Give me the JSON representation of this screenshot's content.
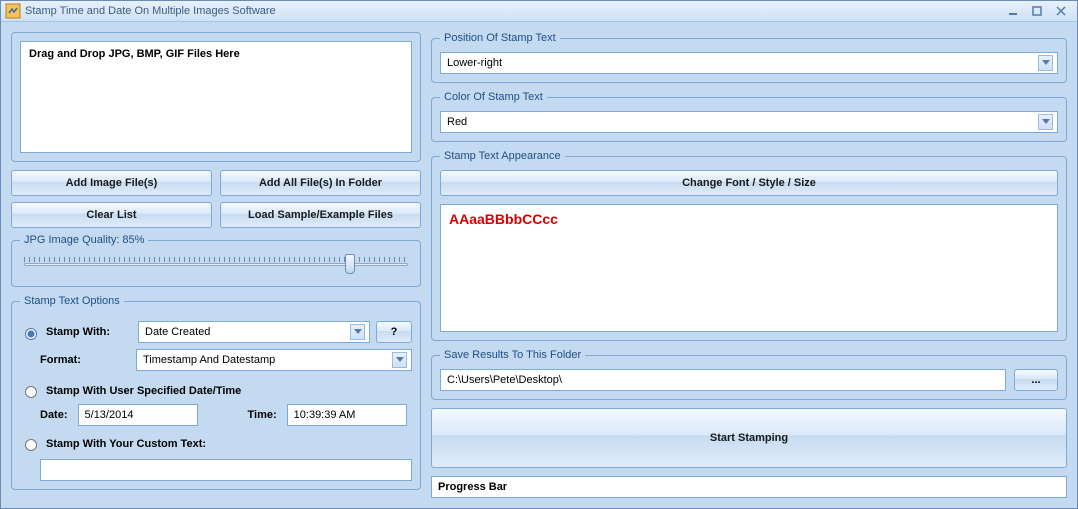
{
  "window": {
    "title": "Stamp Time and Date On Multiple Images Software"
  },
  "left": {
    "drop_placeholder": "Drag and Drop JPG, BMP, GIF Files Here",
    "btn_add_files": "Add Image File(s)",
    "btn_add_folder": "Add All File(s) In Folder",
    "btn_clear": "Clear List",
    "btn_load_sample": "Load Sample/Example Files",
    "quality": {
      "legend": "JPG Image Quality: 85%",
      "percent": 85
    },
    "stamp_options": {
      "legend": "Stamp Text Options",
      "radio_with_label": "Stamp With:",
      "with_value": "Date Created",
      "help_label": "?",
      "format_label": "Format:",
      "format_value": "Timestamp And Datestamp",
      "radio_userdt_label": "Stamp With User Specified Date/Time",
      "date_label": "Date:",
      "date_value": "5/13/2014",
      "time_label": "Time:",
      "time_value": "10:39:39 AM",
      "radio_custom_label": "Stamp With Your Custom Text:",
      "custom_text_value": ""
    }
  },
  "right": {
    "position": {
      "legend": "Position Of Stamp Text",
      "value": "Lower-right"
    },
    "color": {
      "legend": "Color Of Stamp Text",
      "value": "Red"
    },
    "appearance": {
      "legend": "Stamp Text Appearance",
      "btn_font": "Change Font / Style / Size",
      "preview_text": "AAaaBBbbCCcc",
      "preview_color": "#d80000"
    },
    "save": {
      "legend": "Save Results To This Folder",
      "path": "C:\\Users\\Pete\\Desktop\\",
      "browse": "..."
    },
    "btn_start": "Start Stamping",
    "progress_label": "Progress Bar"
  }
}
